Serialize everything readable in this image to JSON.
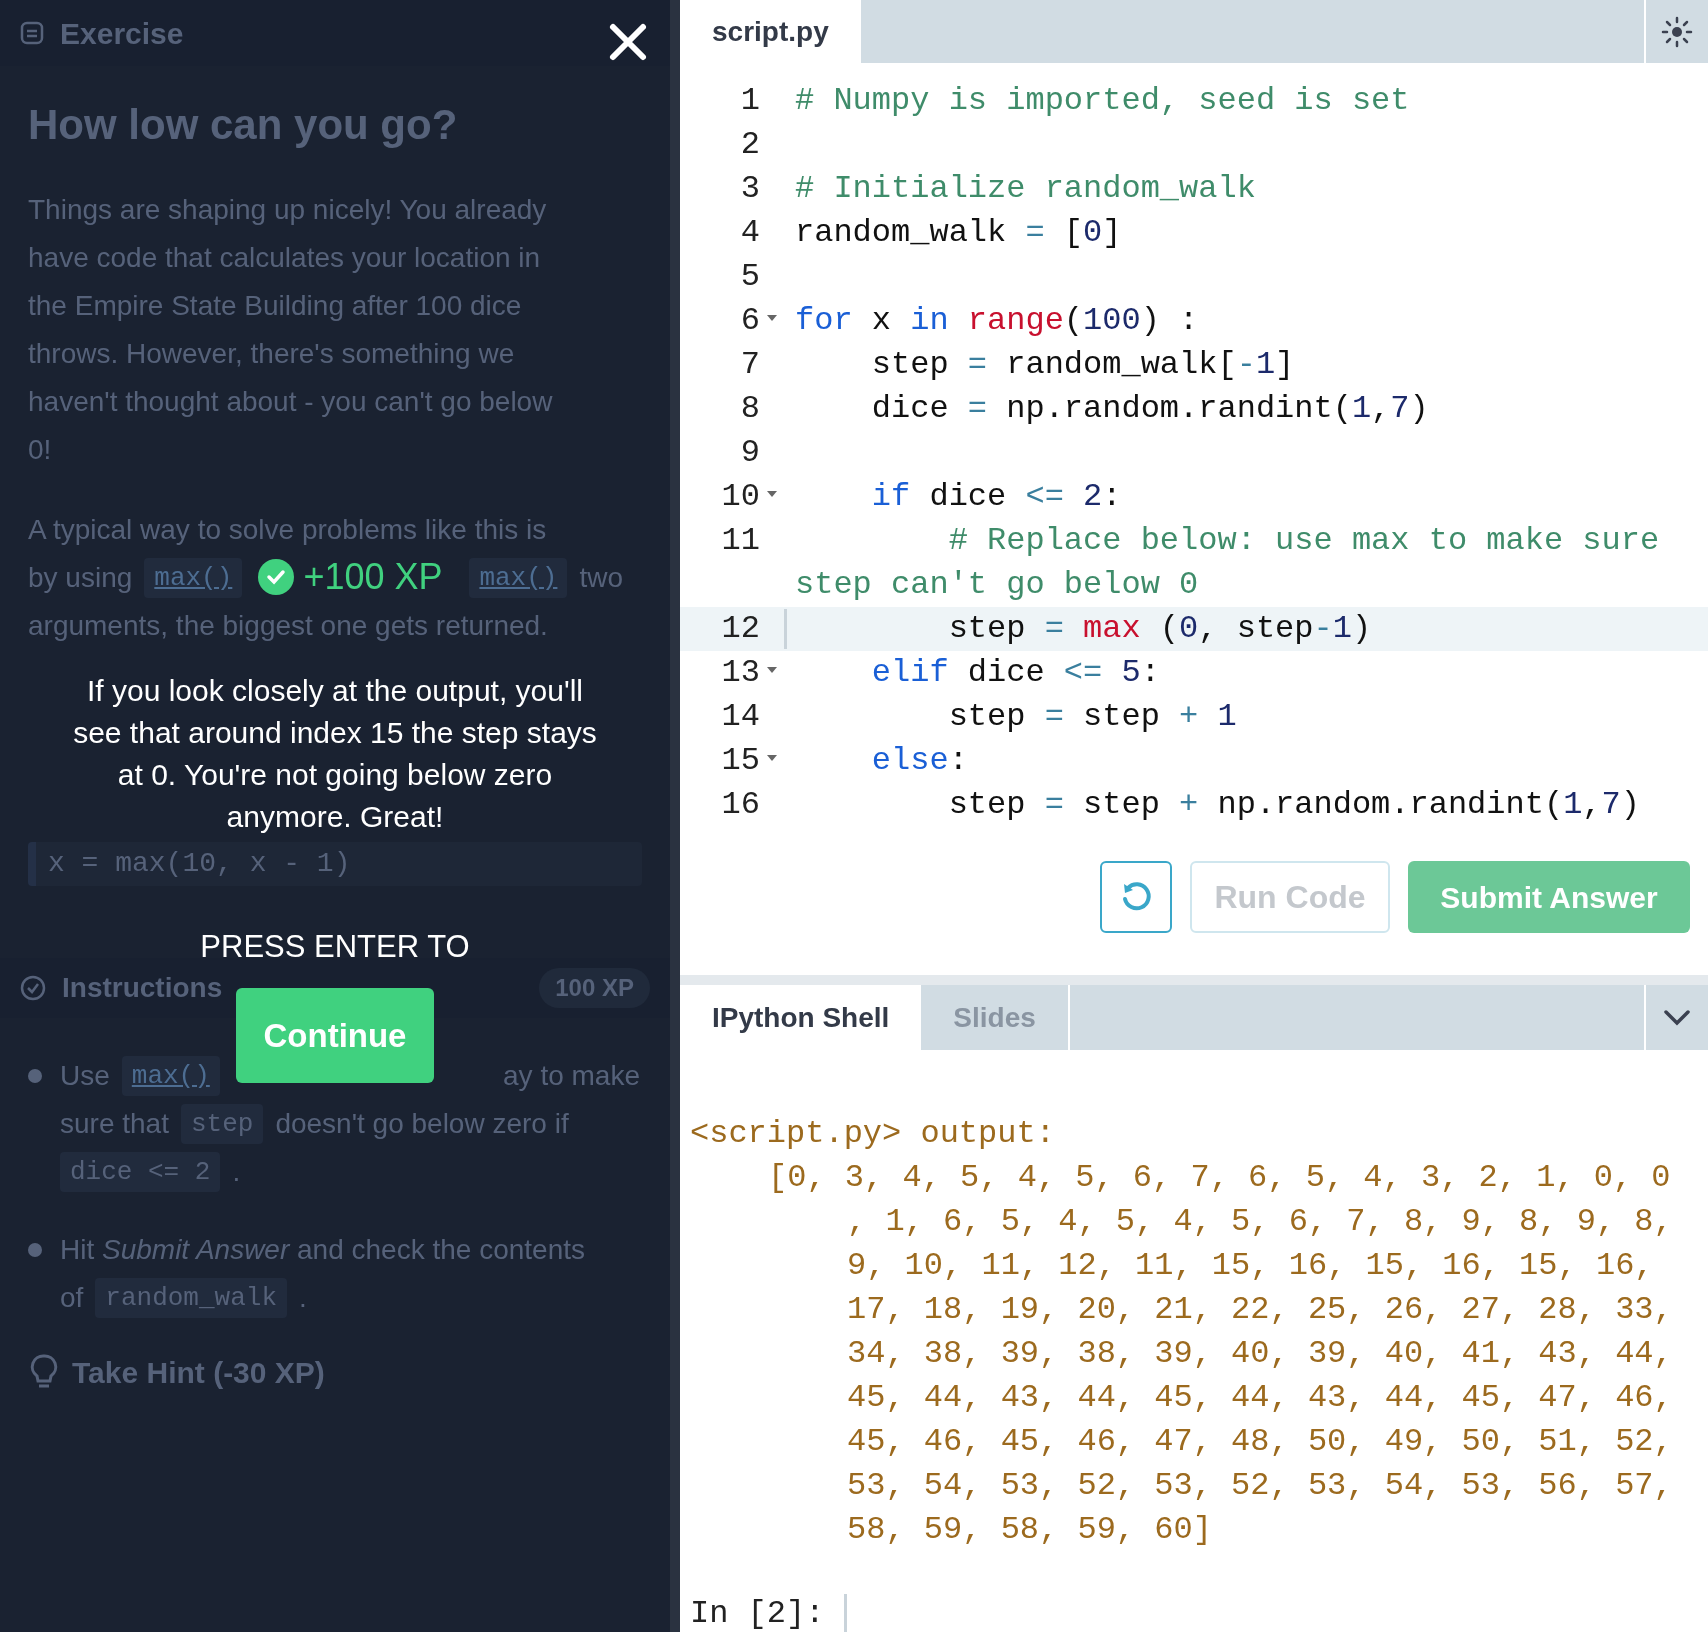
{
  "exercise": {
    "header": "Exercise",
    "title": "How low can you go?",
    "intro_lines": [
      "Things are shaping up nicely! You already",
      "have code that calculates your location in",
      "the Empire State Building after 100 dice",
      "throws. However, there's something we",
      "haven't thought about - you can't go below",
      "0!"
    ],
    "para2_lines": [
      {
        "left": [
          {
            "kind": "text",
            "text": "A typical way to solve problems like this is"
          }
        ]
      },
      {
        "left": [
          {
            "kind": "text",
            "text": "by using"
          },
          {
            "kind": "link",
            "text": "max()"
          }
        ],
        "right": [
          {
            "kind": "link",
            "text": "max()"
          },
          {
            "kind": "text",
            "text": "two"
          }
        ]
      },
      {
        "left": [
          {
            "kind": "text",
            "text": "arguments, the biggest one gets returned."
          }
        ]
      }
    ],
    "code_block": "x = max(10, x - 1)",
    "instructions": {
      "title": "Instructions",
      "xp": "100 XP",
      "bullets": [
        {
          "lines": [
            {
              "left": [
                {
                  "kind": "text",
                  "text": "Use"
                },
                {
                  "kind": "link",
                  "text": "max()"
                }
              ],
              "right": [
                {
                  "kind": "text",
                  "text": "ay to make"
                }
              ]
            },
            {
              "left": [
                {
                  "kind": "text",
                  "text": "sure that"
                },
                {
                  "kind": "code",
                  "text": "step"
                },
                {
                  "kind": "text",
                  "text": "doesn't go below zero if"
                }
              ]
            },
            {
              "left": [
                {
                  "kind": "code",
                  "text": "dice <= 2"
                },
                {
                  "kind": "text",
                  "text": "."
                }
              ]
            }
          ]
        },
        {
          "lines": [
            {
              "left": [
                {
                  "kind": "text",
                  "text": "Hit *Submit Answer* and check the contents"
                }
              ]
            },
            {
              "left": [
                {
                  "kind": "text",
                  "text": "of"
                },
                {
                  "kind": "code",
                  "text": "random_walk"
                },
                {
                  "kind": "text",
                  "text": "."
                }
              ]
            }
          ]
        }
      ]
    },
    "hint": "Take Hint (-30 XP)"
  },
  "popup": {
    "xp": "+100 XP",
    "message": [
      "If you look closely at the output, you'll",
      "see that around index 15 the step stays",
      "at 0. You're not going below zero",
      "anymore. Great!"
    ],
    "prompt": "PRESS ENTER TO",
    "button": "Continue"
  },
  "editor": {
    "tabs": [
      {
        "label": "script.py",
        "selected": true
      }
    ],
    "lines": [
      {
        "number": "1",
        "foldable": false,
        "active": false,
        "tokens": [
          {
            "kind": "comment",
            "text": "# Numpy is imported, seed is set"
          }
        ]
      },
      {
        "number": "2",
        "foldable": false,
        "active": false
      },
      {
        "number": "3",
        "foldable": false,
        "active": false,
        "tokens": [
          {
            "kind": "comment",
            "text": "# Initialize random_walk"
          }
        ]
      },
      {
        "number": "4",
        "foldable": false,
        "active": false,
        "tokens": [
          {
            "kind": "plain",
            "text": "random_walk "
          },
          {
            "kind": "op",
            "text": "="
          },
          {
            "kind": "plain",
            "text": " ["
          },
          {
            "kind": "number",
            "text": "0"
          },
          {
            "kind": "plain",
            "text": "]"
          }
        ]
      },
      {
        "number": "5",
        "foldable": false,
        "active": false
      },
      {
        "number": "6",
        "foldable": true,
        "active": false,
        "tokens": [
          {
            "kind": "keyword",
            "text": "for"
          },
          {
            "kind": "plain",
            "text": " x "
          },
          {
            "kind": "keyword",
            "text": "in "
          },
          {
            "kind": "builtin",
            "text": "range"
          },
          {
            "kind": "plain",
            "text": "("
          },
          {
            "kind": "number",
            "text": "100"
          },
          {
            "kind": "plain",
            "text": ") :"
          }
        ]
      },
      {
        "number": "7",
        "foldable": false,
        "active": false,
        "tokens": [
          {
            "kind": "plain",
            "text": "    step "
          },
          {
            "kind": "op",
            "text": "="
          },
          {
            "kind": "plain",
            "text": " random_walk["
          },
          {
            "kind": "op",
            "text": "-"
          },
          {
            "kind": "number",
            "text": "1"
          },
          {
            "kind": "plain",
            "text": "]"
          }
        ]
      },
      {
        "number": "8",
        "foldable": false,
        "active": false,
        "tokens": [
          {
            "kind": "plain",
            "text": "    dice "
          },
          {
            "kind": "op",
            "text": "="
          },
          {
            "kind": "plain",
            "text": " np.random.randint("
          },
          {
            "kind": "number",
            "text": "1"
          },
          {
            "kind": "plain",
            "text": ","
          },
          {
            "kind": "number",
            "text": "7"
          },
          {
            "kind": "plain",
            "text": ")"
          }
        ]
      },
      {
        "number": "9",
        "foldable": false,
        "active": false
      },
      {
        "number": "10",
        "foldable": true,
        "active": false,
        "tokens": [
          {
            "kind": "keyword",
            "text": "    if"
          },
          {
            "kind": "plain",
            "text": " dice "
          },
          {
            "kind": "op",
            "text": "<="
          },
          {
            "kind": "number",
            "text": " 2"
          },
          {
            "kind": "plain",
            "text": ":"
          }
        ]
      },
      {
        "number": "11",
        "foldable": false,
        "active": false,
        "tokens": [
          {
            "kind": "comment",
            "text": "        # Replace below: use max to make sure step can't go below 0"
          }
        ]
      },
      {
        "number": "12",
        "foldable": false,
        "active": true,
        "tokens": [
          {
            "kind": "plain",
            "text": "        step "
          },
          {
            "kind": "op",
            "text": "="
          },
          {
            "kind": "builtin",
            "text": " max"
          },
          {
            "kind": "plain",
            "text": " ("
          },
          {
            "kind": "number",
            "text": "0"
          },
          {
            "kind": "plain",
            "text": ", step"
          },
          {
            "kind": "op",
            "text": "-"
          },
          {
            "kind": "number",
            "text": "1"
          },
          {
            "kind": "plain",
            "text": ")"
          }
        ]
      },
      {
        "number": "13",
        "foldable": true,
        "active": false,
        "tokens": [
          {
            "kind": "keyword",
            "text": "    elif"
          },
          {
            "kind": "plain",
            "text": " dice "
          },
          {
            "kind": "op",
            "text": "<="
          },
          {
            "kind": "number",
            "text": " 5"
          },
          {
            "kind": "plain",
            "text": ":"
          }
        ]
      },
      {
        "number": "14",
        "foldable": false,
        "active": false,
        "tokens": [
          {
            "kind": "plain",
            "text": "        step "
          },
          {
            "kind": "op",
            "text": "="
          },
          {
            "kind": "plain",
            "text": " step "
          },
          {
            "kind": "op",
            "text": "+"
          },
          {
            "kind": "number",
            "text": " 1"
          }
        ]
      },
      {
        "number": "15",
        "foldable": true,
        "active": false,
        "tokens": [
          {
            "kind": "keyword",
            "text": "    else"
          },
          {
            "kind": "plain",
            "text": ":"
          }
        ]
      },
      {
        "number": "16",
        "foldable": false,
        "active": false,
        "tokens": [
          {
            "kind": "plain",
            "text": "        step "
          },
          {
            "kind": "op",
            "text": "="
          },
          {
            "kind": "plain",
            "text": " step "
          },
          {
            "kind": "op",
            "text": "+"
          },
          {
            "kind": "plain",
            "text": " np.random.randint("
          },
          {
            "kind": "number",
            "text": "1"
          },
          {
            "kind": "plain",
            "text": ","
          },
          {
            "kind": "number",
            "text": "7"
          },
          {
            "kind": "plain",
            "text": ")"
          }
        ]
      }
    ],
    "buttons": {
      "run": "Run Code",
      "submit": "Submit Answer"
    }
  },
  "shell": {
    "tabs": [
      {
        "label": "IPython Shell",
        "selected": true
      },
      {
        "label": "Slides",
        "selected": false
      }
    ],
    "header": "<script.py> output:",
    "output": [
      "[0, 3, 4, 5, 4, 5, 6, 7, 6, 5, 4, 3, 2, 1, 0, 0",
      ", 1, 6, 5, 4, 5, 4, 5, 6, 7, 8, 9, 8, 9, 8,",
      "9, 10, 11, 12, 11, 15, 16, 15, 16, 15, 16,",
      "17, 18, 19, 20, 21, 22, 25, 26, 27, 28, 33,",
      "34, 38, 39, 38, 39, 40, 39, 40, 41, 43, 44,",
      "45, 44, 43, 44, 45, 44, 43, 44, 45, 47, 46,",
      "45, 46, 45, 46, 47, 48, 50, 49, 50, 51, 52,",
      "53, 54, 53, 52, 53, 52, 53, 54, 53, 56, 57,",
      "58, 59, 58, 59, 60]"
    ],
    "prompt": "In [2]:"
  }
}
